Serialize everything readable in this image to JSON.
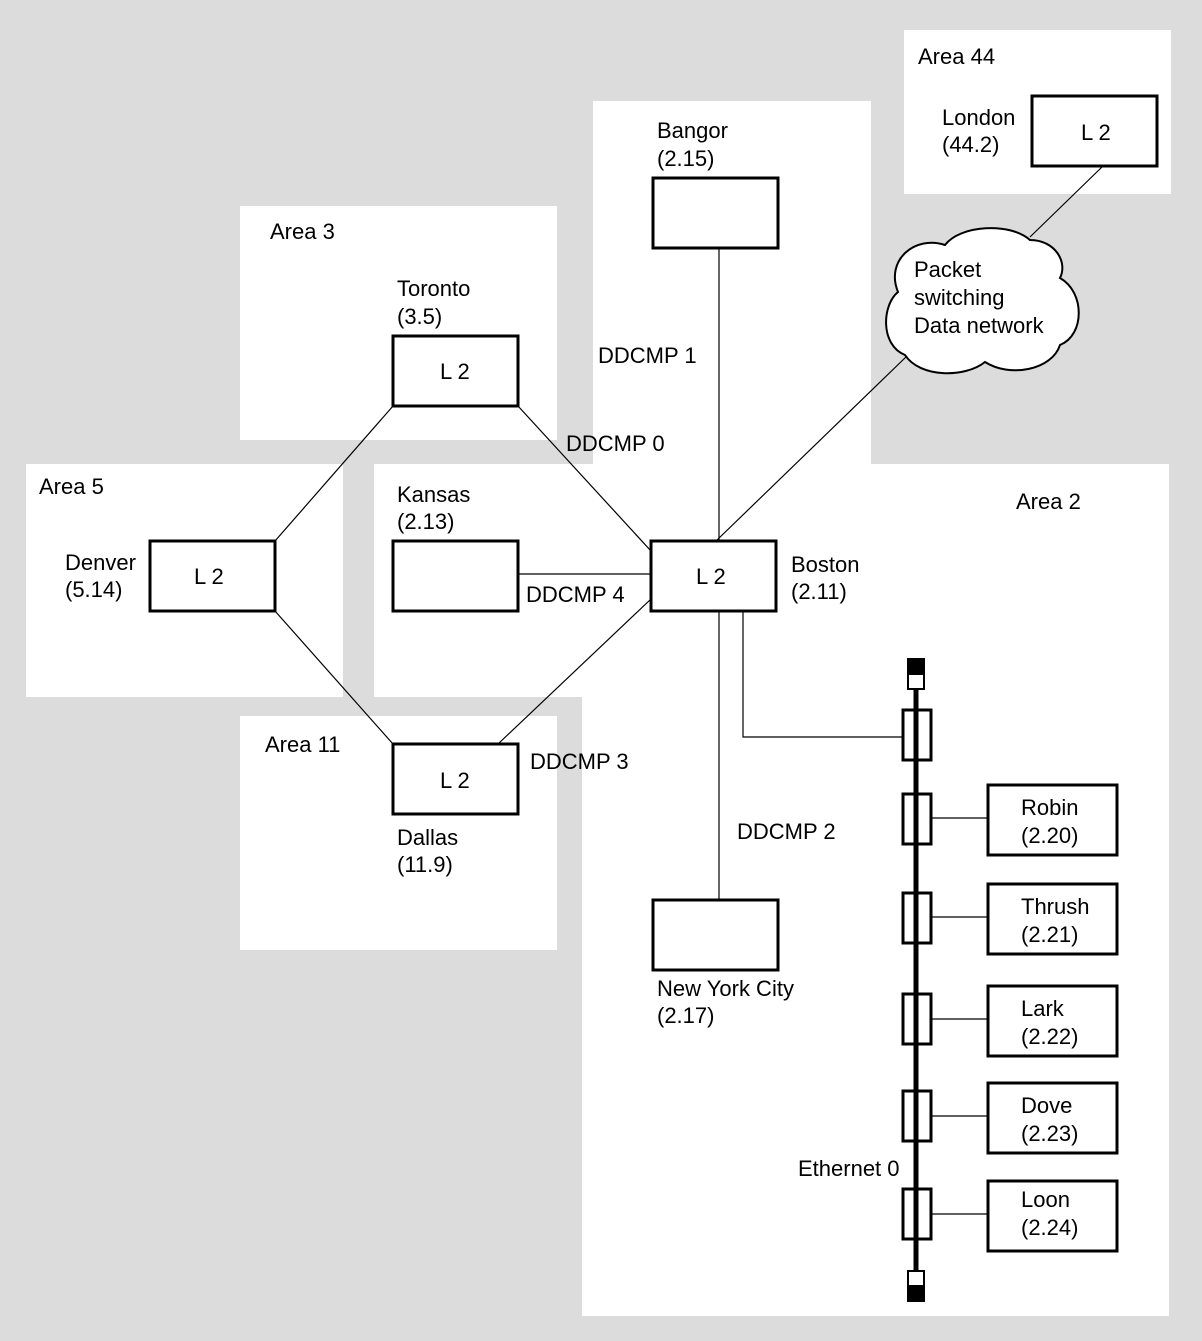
{
  "colors": {
    "background": "#dcdcdc",
    "area": "#ffffff",
    "ink": "#000000"
  },
  "areas": {
    "a44": "Area 44",
    "a3": "Area 3",
    "a5": "Area 5",
    "a2": "Area 2",
    "a11": "Area 11"
  },
  "nodes": {
    "london": {
      "name": "London",
      "addr": "(44.2)",
      "label": "L 2"
    },
    "bangor": {
      "name": "Bangor",
      "addr": "(2.15)"
    },
    "toronto": {
      "name": "Toronto",
      "addr": "(3.5)",
      "label": "L 2"
    },
    "kansas": {
      "name": "Kansas",
      "addr": "(2.13)"
    },
    "denver": {
      "name": "Denver",
      "addr": "(5.14)",
      "label": "L 2"
    },
    "boston": {
      "name": "Boston",
      "addr": "(2.11)",
      "label": "L 2"
    },
    "dallas": {
      "name": "Dallas",
      "addr": "(11.9)",
      "label": "L 2"
    },
    "nyc": {
      "name": "New York City",
      "addr": "(2.17)"
    },
    "robin": {
      "name": "Robin",
      "addr": "(2.20)"
    },
    "thrush": {
      "name": "Thrush",
      "addr": "(2.21)"
    },
    "lark": {
      "name": "Lark",
      "addr": "(2.22)"
    },
    "dove": {
      "name": "Dove",
      "addr": "(2.23)"
    },
    "loon": {
      "name": "Loon",
      "addr": "(2.24)"
    }
  },
  "cloud": {
    "line1": "Packet",
    "line2": "switching",
    "line3": "Data network"
  },
  "links": {
    "d0": "DDCMP 0",
    "d1": "DDCMP 1",
    "d2": "DDCMP 2",
    "d3": "DDCMP 3",
    "d4": "DDCMP 4",
    "eth": "Ethernet 0"
  }
}
